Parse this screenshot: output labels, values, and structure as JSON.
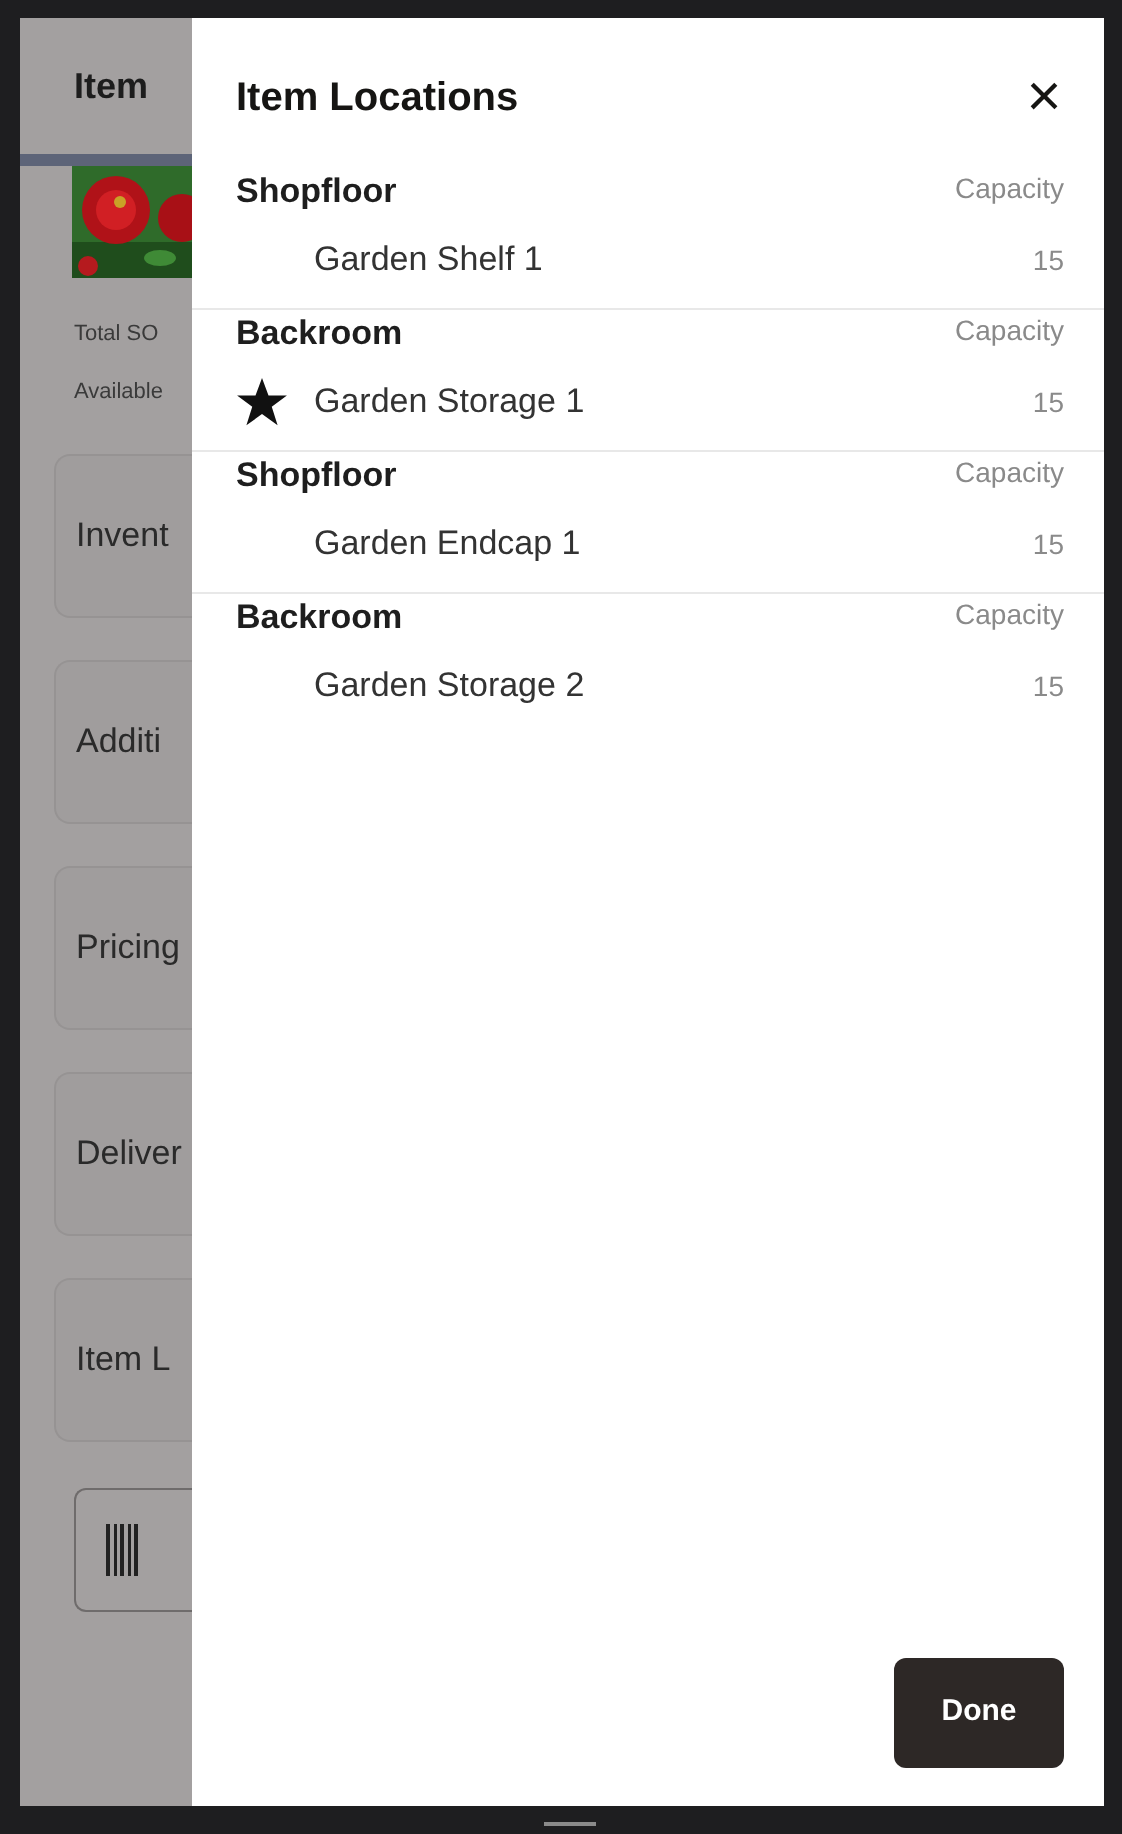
{
  "background": {
    "title": "Item",
    "labels": [
      "Total SO",
      "Available"
    ],
    "cards": [
      "Invent",
      "Additi",
      "Pricing",
      "Deliver",
      "Item L"
    ]
  },
  "dialog": {
    "title": "Item Locations",
    "close": "×",
    "locations": [
      {
        "area": "Shopfloor",
        "capacity_label": "Capacity",
        "name": "Garden Shelf 1",
        "capacity": "15",
        "starred": false
      },
      {
        "area": "Backroom",
        "capacity_label": "Capacity",
        "name": "Garden Storage 1",
        "capacity": "15",
        "starred": true
      },
      {
        "area": "Shopfloor",
        "capacity_label": "Capacity",
        "name": "Garden Endcap 1",
        "capacity": "15",
        "starred": false
      },
      {
        "area": "Backroom",
        "capacity_label": "Capacity",
        "name": "Garden Storage 2",
        "capacity": "15",
        "starred": false
      }
    ],
    "done": "Done"
  }
}
